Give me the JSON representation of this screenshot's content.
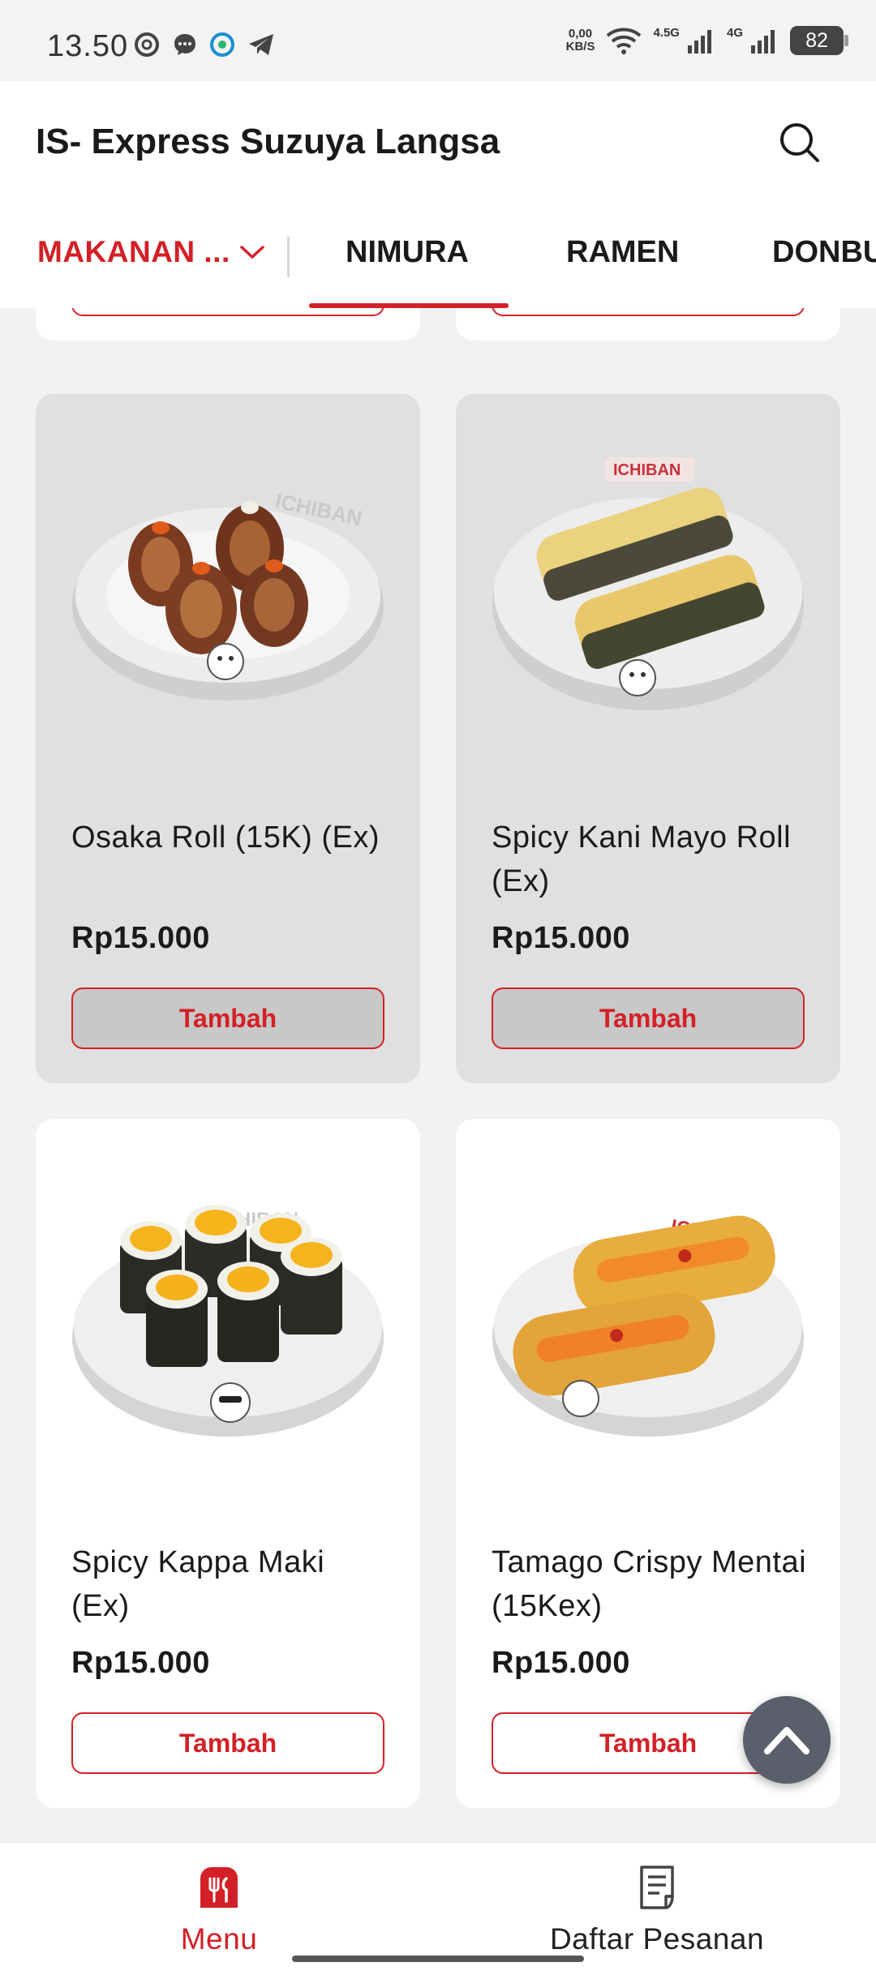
{
  "status_bar": {
    "time": "13.50",
    "net_speed_value": "0,00",
    "net_speed_unit": "KB/S",
    "network_1": "4.5G",
    "network_2": "4G",
    "battery": "82"
  },
  "header": {
    "title": "IS- Express Suzuya Langsa",
    "search_icon": "search-icon"
  },
  "tabs": {
    "category_dropdown": "MAKANAN ...",
    "items": [
      "NIMURA",
      "RAMEN",
      "DONBURI"
    ],
    "active_index": 0
  },
  "products": [
    {
      "name": "Osaka Roll (15K) (Ex)",
      "price": "Rp15.000",
      "button": "Tambah"
    },
    {
      "name": "Spicy Kani Mayo Roll (Ex)",
      "price": "Rp15.000",
      "button": "Tambah"
    },
    {
      "name": "Spicy Kappa Maki (Ex)",
      "price": "Rp15.000",
      "button": "Tambah"
    },
    {
      "name": "Tamago Crispy Mentai (15Kex)",
      "price": "Rp15.000",
      "button": "Tambah"
    }
  ],
  "bottom_nav": {
    "items": [
      {
        "label": "Menu",
        "icon": "restaurant-icon",
        "active": true
      },
      {
        "label": "Daftar Pesanan",
        "icon": "receipt-icon",
        "active": false
      }
    ]
  },
  "colors": {
    "accent": "#d32026",
    "fab": "#5a5f6b"
  }
}
